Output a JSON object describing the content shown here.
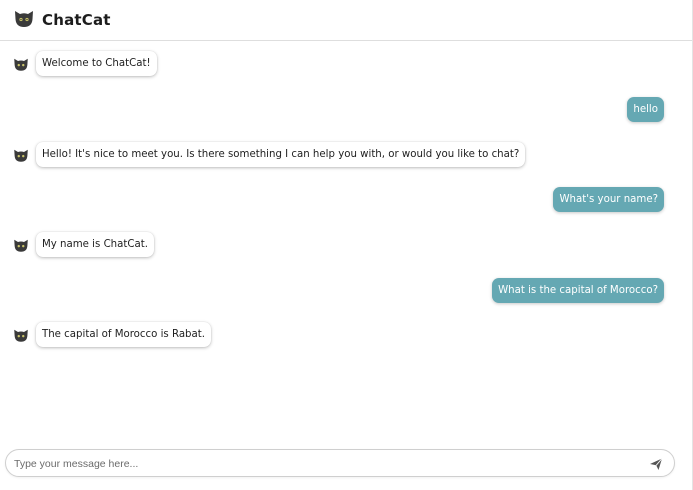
{
  "header": {
    "title": "ChatCat",
    "logo_icon": "cat-face-icon"
  },
  "messages": [
    {
      "sender": "bot",
      "text": "Welcome to ChatCat!"
    },
    {
      "sender": "user",
      "text": "hello"
    },
    {
      "sender": "bot",
      "text": "Hello! It's nice to meet you. Is there something I can help you with, or would you like to chat?"
    },
    {
      "sender": "user",
      "text": "What's your name?"
    },
    {
      "sender": "bot",
      "text": "My name is ChatCat."
    },
    {
      "sender": "user",
      "text": "What is the capital of Morocco?"
    },
    {
      "sender": "bot",
      "text": "The capital of Morocco is Rabat."
    }
  ],
  "composer": {
    "placeholder": "Type your message here...",
    "value": "",
    "send_icon": "send-icon"
  },
  "colors": {
    "user_bubble": "#65a8b3",
    "bot_bubble": "#ffffff",
    "avatar": "#3a3a3a"
  }
}
